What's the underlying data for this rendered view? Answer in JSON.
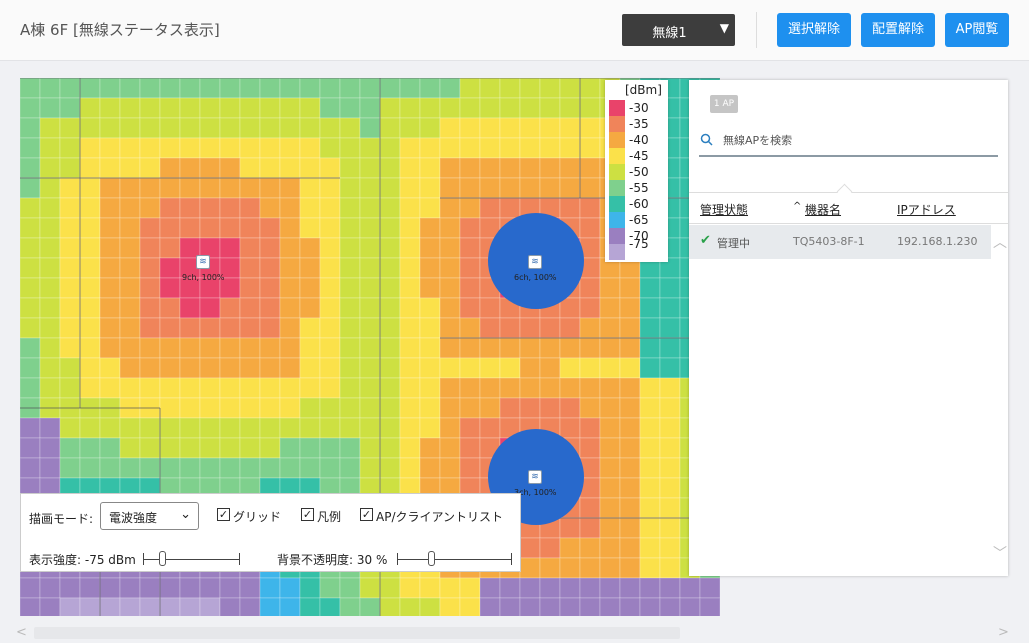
{
  "header": {
    "title": "A棟 6F [無線ステータス表示]",
    "band_select": "無線1",
    "buttons": {
      "deselect": "選択解除",
      "unplace": "配置解除",
      "ap_view": "AP閲覧"
    }
  },
  "legend": {
    "title": "[dBm]",
    "items": [
      {
        "label": "-30",
        "color": "#e9436a"
      },
      {
        "label": "-35",
        "color": "#f0845a"
      },
      {
        "label": "-40",
        "color": "#f5a941"
      },
      {
        "label": "-45",
        "color": "#fbe14a"
      },
      {
        "label": "-50",
        "color": "#cde042"
      },
      {
        "label": "-55",
        "color": "#7fd08d"
      },
      {
        "label": "-60",
        "color": "#35c0a7"
      },
      {
        "label": "-65",
        "color": "#3eb5ea"
      },
      {
        "label": "-70",
        "color": "#9a7fc0"
      },
      {
        "label": "-75",
        "color": "#b6a5d5"
      }
    ]
  },
  "access_points": [
    {
      "label": "9ch, 100%",
      "strength": "strong"
    },
    {
      "label": "6ch, 100%",
      "selected": true
    },
    {
      "label": "3ch, 100%",
      "selected": true
    }
  ],
  "controls": {
    "mode_label": "描画モード:",
    "mode_value": "電波強度",
    "grid": {
      "label": "グリッド",
      "checked": true
    },
    "legend": {
      "label": "凡例",
      "checked": true
    },
    "ap_list": {
      "label": "AP/クライアントリスト",
      "checked": true
    },
    "strength_label": "表示強度: -75 dBm",
    "strength_fraction": 0.2,
    "opacity_label": "背景不透明度: 30 %",
    "opacity_fraction": 0.3
  },
  "panel": {
    "ap_count": "1 AP",
    "search_placeholder": "無線APを検索",
    "columns": {
      "status": "管理状態",
      "sort_indicator": "^",
      "name": "機器名",
      "ip": "IPアドレス"
    },
    "rows": [
      {
        "status": "管理中",
        "name": "TQ5403-8F-1",
        "ip": "192.168.1.230"
      }
    ]
  },
  "colors": {
    "accent": "#1e90ef",
    "selected_ap": "#2869cc",
    "status_ok": "#2aa14a"
  }
}
